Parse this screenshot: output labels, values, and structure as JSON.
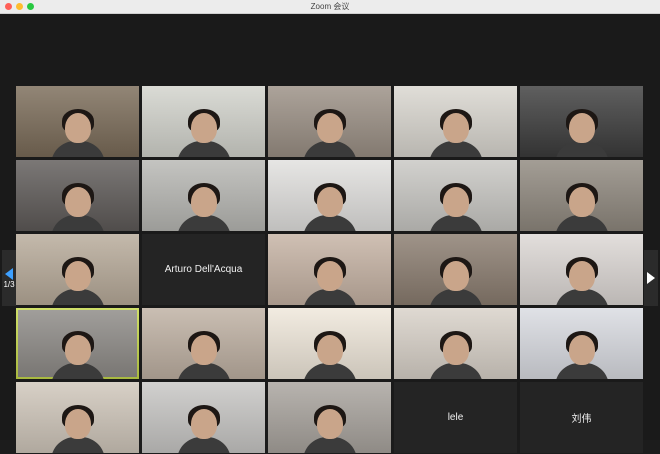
{
  "window": {
    "title": "Zoom 会议"
  },
  "pagination": {
    "left_page": "1/3",
    "right_page": ""
  },
  "tiles": [
    {
      "type": "video",
      "bg": "#7a6b58"
    },
    {
      "type": "video",
      "bg": "#d2d3cc"
    },
    {
      "type": "video",
      "bg": "#9a8f84"
    },
    {
      "type": "video",
      "bg": "#d9d6cf"
    },
    {
      "type": "video",
      "bg": "#3c3c3c"
    },
    {
      "type": "video",
      "bg": "#5e5a58"
    },
    {
      "type": "video",
      "bg": "#b7b7b3"
    },
    {
      "type": "video",
      "bg": "#e1e0de"
    },
    {
      "type": "video",
      "bg": "#c8c7c3"
    },
    {
      "type": "video",
      "bg": "#8f887e"
    },
    {
      "type": "video",
      "bg": "#b7aa99"
    },
    {
      "type": "name",
      "label": "Arturo Dell'Acqua"
    },
    {
      "type": "video",
      "bg": "#c5b2a3"
    },
    {
      "type": "video",
      "bg": "#8a7c6f"
    },
    {
      "type": "video",
      "bg": "#dcd7d4"
    },
    {
      "type": "video",
      "bg": "#8d8a86",
      "active": true
    },
    {
      "type": "video",
      "bg": "#beb0a2"
    },
    {
      "type": "video",
      "bg": "#efe7da"
    },
    {
      "type": "video",
      "bg": "#d8d1c8"
    },
    {
      "type": "video",
      "bg": "#d9dbe1"
    },
    {
      "type": "video",
      "bg": "#cfc6ba"
    },
    {
      "type": "video",
      "bg": "#c7c6c4"
    },
    {
      "type": "video",
      "bg": "#a8a39d"
    },
    {
      "type": "name",
      "label": "lele"
    },
    {
      "type": "name",
      "label": "刘伟"
    }
  ],
  "colors": {
    "active_speaker": "#c6d94a",
    "tile_bg": "#2a2a2a",
    "stage_bg": "#1a1a1a"
  }
}
